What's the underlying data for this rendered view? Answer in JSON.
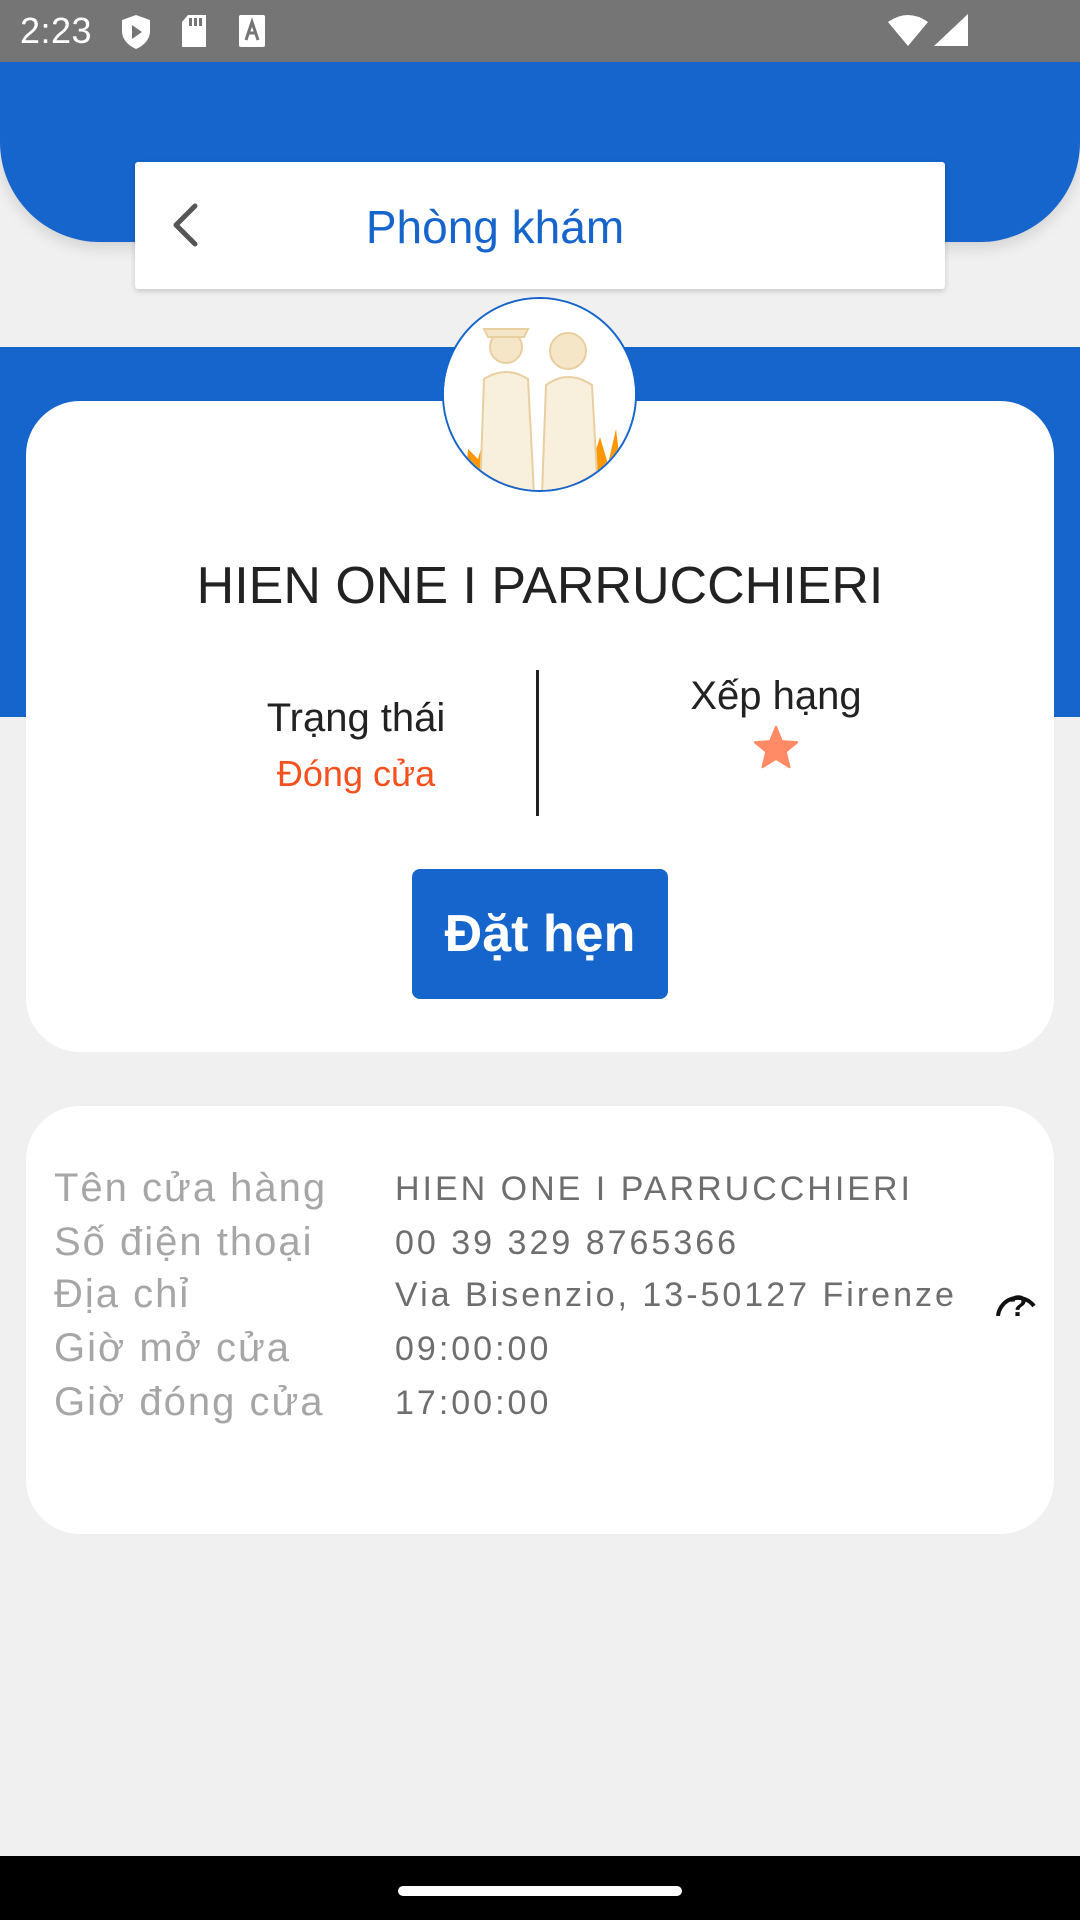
{
  "status_bar": {
    "time": "2:23",
    "icons": [
      "shield-play-icon",
      "sd-card-icon",
      "a-font-icon",
      "wifi-icon",
      "signal-icon"
    ]
  },
  "header": {
    "title": "Phòng khám",
    "back_icon": "chevron-left-icon"
  },
  "profile": {
    "avatar_icon": "people-silhouette-avatar",
    "name": "HIEN ONE I PARRUCCHIERI",
    "status_label": "Trạng thái",
    "status_value": "Đóng cửa",
    "rating_label": "Xếp hạng",
    "rating_stars": 1,
    "book_button": "Đặt hẹn"
  },
  "info": {
    "rows": [
      {
        "label": "Tên cửa hàng",
        "value": "HIEN ONE I PARRUCCHIERI"
      },
      {
        "label": "Số điện thoại",
        "value": "00 39 329 8765366"
      },
      {
        "label": "Địa chỉ",
        "value": "Via Bisenzio, 13-50127 Firenze"
      },
      {
        "label": "Giờ mở cửa",
        "value": "09:00:00"
      },
      {
        "label": "Giờ đóng cửa",
        "value": "17:00:00"
      }
    ],
    "help_icon": "help-question-icon"
  },
  "colors": {
    "primary": "#1565cc",
    "closed": "#f4511e",
    "star": "#ff8a65",
    "label_gray": "#a6a6a6"
  }
}
